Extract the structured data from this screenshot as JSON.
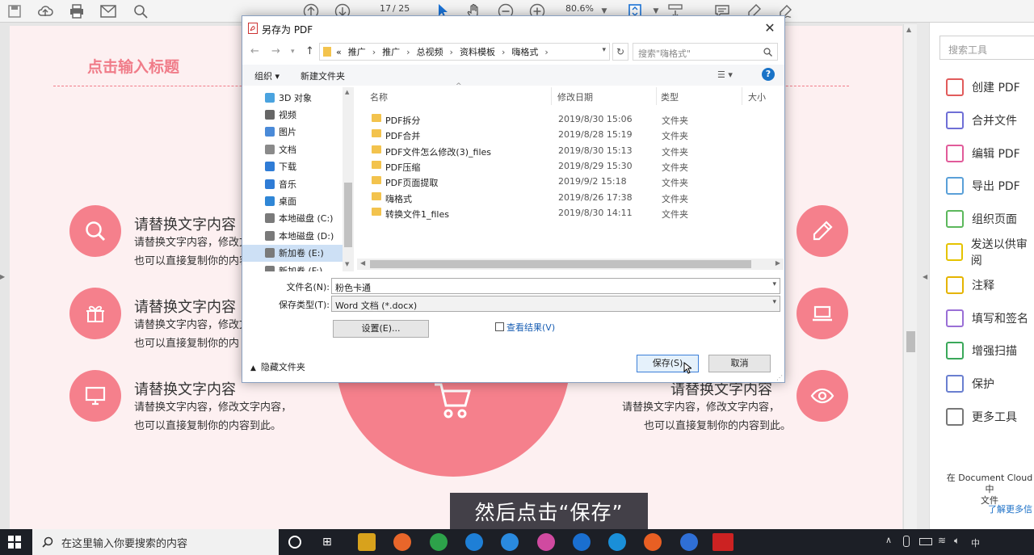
{
  "toolbar": {
    "page_current": "17",
    "page_total": "/ 25",
    "zoom": "80.6%"
  },
  "doc": {
    "title": "点击输入标题",
    "items": [
      {
        "title": "请替换文字内容",
        "line1": "请替换文字内容，修改文",
        "line2": "也可以直接复制你的内容"
      },
      {
        "title": "请替换文字内容",
        "line1": "请替换文字内容，修改文",
        "line2": "也可以直接复制你的内"
      },
      {
        "title": "请替换文字内容",
        "line1": "请替换文字内容，修改文字内容，",
        "line2": "也可以直接复制你的内容到此。"
      }
    ],
    "right_item": {
      "title": "请替换文字内容",
      "line1": "请替换文字内容，修改文字内容，",
      "line2": "也可以直接复制你的内容到此。"
    }
  },
  "right_panel": {
    "search_placeholder": "搜索工具",
    "tools": [
      "创建 PDF",
      "合并文件",
      "编辑 PDF",
      "导出 PDF",
      "组织页面",
      "发送以供审阅",
      "注释",
      "填写和签名",
      "增强扫描",
      "保护",
      "更多工具"
    ],
    "tool_colors": [
      "#e15b5b",
      "#6f6fd6",
      "#e15b9a",
      "#5aa0d8",
      "#5cb85c",
      "#e5c300",
      "#e5b400",
      "#9a6fd6",
      "#3aa85a",
      "#6a7fd0",
      "#777777"
    ],
    "cloud_line1": "在 Document Cloud 中",
    "cloud_line2": "文件",
    "learn_more": "了解更多信"
  },
  "caption": "然后点击“保存”",
  "dialog": {
    "title": "另存为 PDF",
    "path": [
      "«",
      "推广",
      "推广",
      "总视频",
      "资料模板",
      "嗨格式"
    ],
    "search_placeholder": "搜索\"嗨格式\"",
    "organize": "组织 ▾",
    "new_folder": "新建文件夹",
    "nav_items": [
      "3D 对象",
      "视频",
      "图片",
      "文档",
      "下载",
      "音乐",
      "桌面",
      "本地磁盘 (C:)",
      "本地磁盘 (D:)",
      "新加卷 (E:)",
      "新加卷 (F:)"
    ],
    "nav_colors": [
      "#4aa3df",
      "#666666",
      "#4a8ad8",
      "#8a8a8a",
      "#2f7cd6",
      "#2f7cd6",
      "#2f86d6",
      "#7a7a7a",
      "#7a7a7a",
      "#7a7a7a",
      "#7a7a7a"
    ],
    "columns": {
      "name": "名称",
      "modified": "修改日期",
      "type": "类型",
      "size": "大小"
    },
    "files": [
      {
        "name": "PDF拆分",
        "date": "2019/8/30 15:06",
        "type": "文件夹"
      },
      {
        "name": "PDF合并",
        "date": "2019/8/28 15:19",
        "type": "文件夹"
      },
      {
        "name": "PDF文件怎么修改(3)_files",
        "date": "2019/8/30 15:13",
        "type": "文件夹"
      },
      {
        "name": "PDF压缩",
        "date": "2019/8/29 15:30",
        "type": "文件夹"
      },
      {
        "name": "PDF页面提取",
        "date": "2019/9/2 15:18",
        "type": "文件夹"
      },
      {
        "name": "嗨格式",
        "date": "2019/8/26 17:38",
        "type": "文件夹"
      },
      {
        "name": "转换文件1_files",
        "date": "2019/8/30 14:11",
        "type": "文件夹"
      }
    ],
    "filename_label": "文件名(N):",
    "filename_value": "粉色卡通",
    "filetype_label": "保存类型(T):",
    "filetype_value": "Word 文档 (*.docx)",
    "settings_button": "设置(E)...",
    "view_results": "查看结果(V)",
    "hide_folders": "隐藏文件夹",
    "save_button": "保存(S)",
    "cancel_button": "取消"
  },
  "taskbar": {
    "search_placeholder": "在这里输入你要搜索的内容",
    "app_colors": [
      "#d8a21c",
      "#e8662a",
      "#2da24a",
      "#1e7fd6",
      "#2a8adf",
      "#d04aa0",
      "#1a6fd0",
      "#1a8fd8",
      "#e85f23",
      "#2f6fd6",
      "#cc2222"
    ],
    "ime": "中"
  }
}
